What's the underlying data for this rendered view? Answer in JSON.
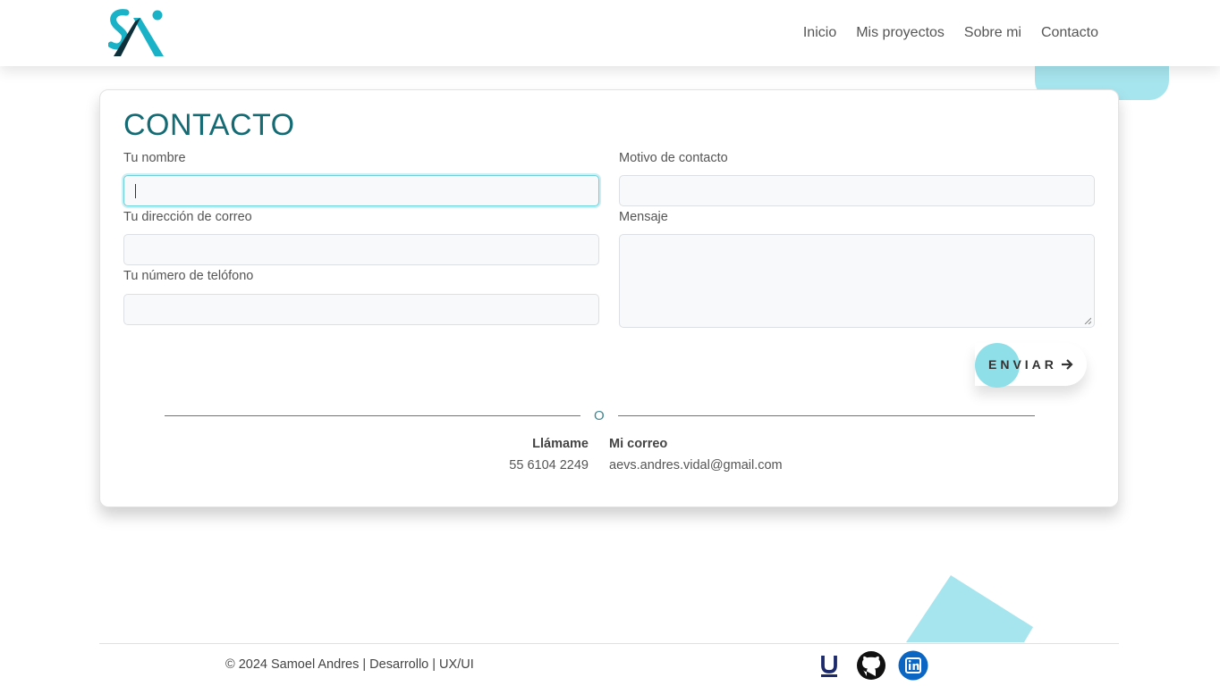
{
  "header": {
    "logo_alt": "SA",
    "nav": [
      "Inicio",
      "Mis proyectos",
      "Sobre mi",
      "Contacto"
    ]
  },
  "form": {
    "title": "CONTACTO",
    "name_label": "Tu nombre",
    "name_value": "",
    "email_label": "Tu dirección de correo",
    "email_value": "",
    "phone_label": "Tu número de telófono",
    "phone_value": "",
    "reason_label": "Motivo de contacto",
    "reason_value": "",
    "message_label": "Mensaje",
    "message_value": "",
    "send_label": "ENVIAR"
  },
  "contact": {
    "separator": "O",
    "call_title": "Llámame",
    "phone": "55 6104 2249",
    "mail_title": "Mi correo",
    "email": "aevs.andres.vidal@gmail.com"
  },
  "footer": {
    "copyright": "© 2024 Samoel Andres | Desarrollo | UX/UI",
    "icons": [
      "udemy-icon",
      "github-icon",
      "linkedin-icon"
    ]
  },
  "colors": {
    "accent": "#146b74",
    "light_accent": "#a7e5ee",
    "linkedin": "#0a66c2"
  }
}
